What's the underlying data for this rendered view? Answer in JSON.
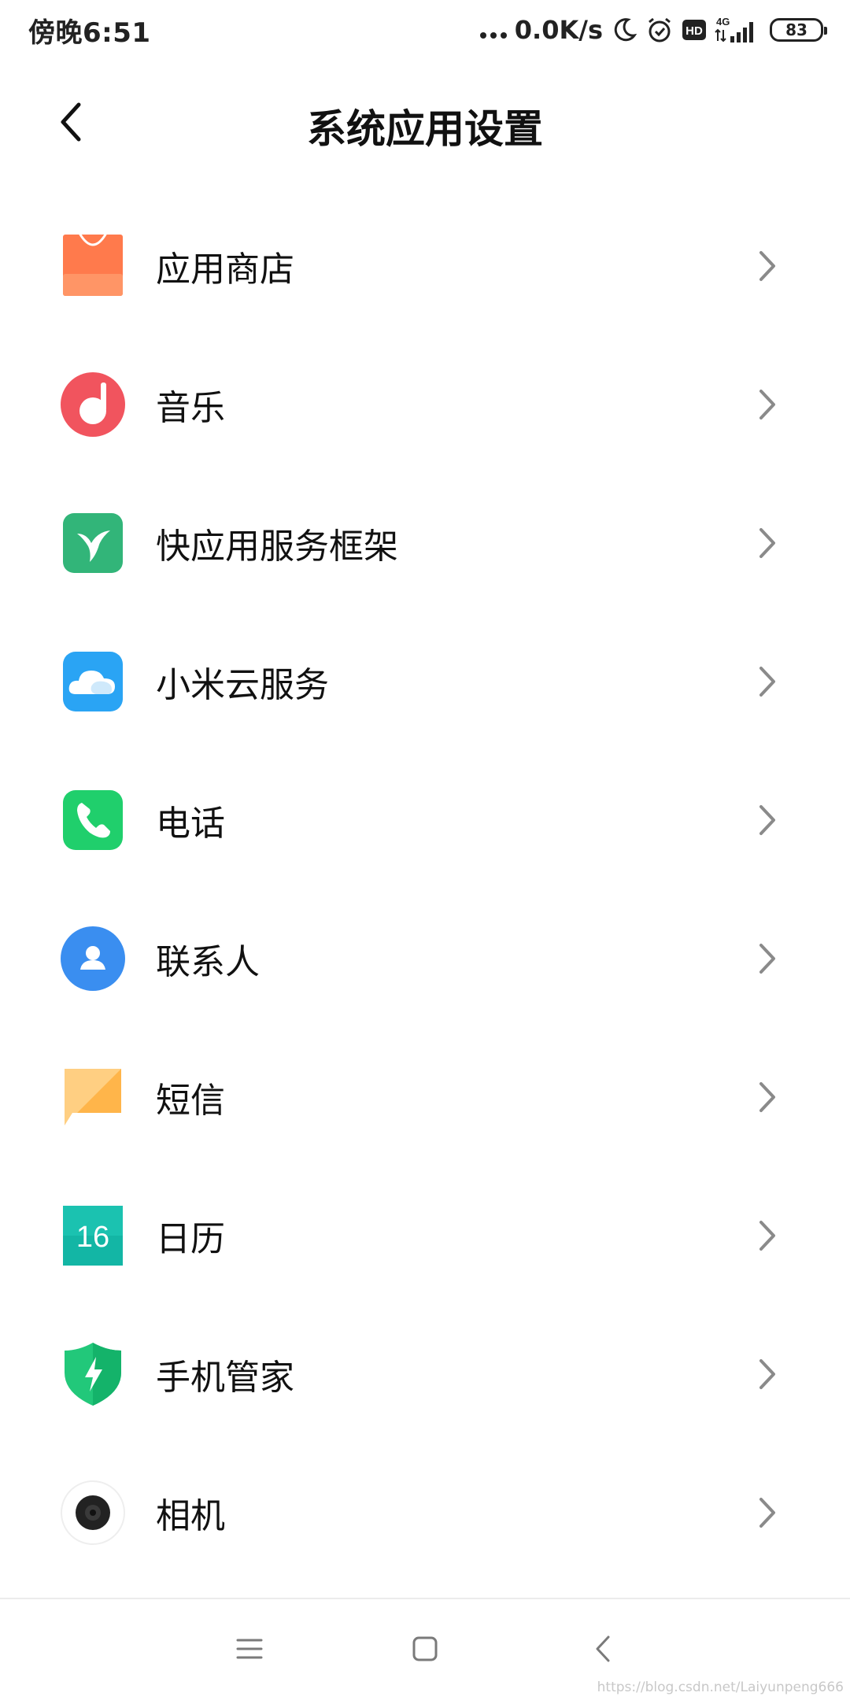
{
  "status_bar": {
    "time": "傍晚6:51",
    "network_speed": "0.0K/s",
    "network_type": "4G",
    "hd_label": "HD",
    "battery": "83",
    "icons": [
      "moon-icon",
      "alarm-icon",
      "hd-icon",
      "signal-icon",
      "battery-icon"
    ]
  },
  "header": {
    "back_icon": "back-arrow-icon",
    "title": "系统应用设置"
  },
  "app_list": [
    {
      "label": "应用商店",
      "icon": "app-store-icon",
      "color": "#ff7a4c"
    },
    {
      "label": "音乐",
      "icon": "music-icon",
      "color": "#f1545e"
    },
    {
      "label": "快应用服务框架",
      "icon": "quick-app-icon",
      "color": "#32b579"
    },
    {
      "label": "小米云服务",
      "icon": "cloud-icon",
      "color": "#2aa4f4"
    },
    {
      "label": "电话",
      "icon": "phone-icon",
      "color": "#20cf6c"
    },
    {
      "label": "联系人",
      "icon": "contacts-icon",
      "color": "#3a8ef0"
    },
    {
      "label": "短信",
      "icon": "messages-icon",
      "color": "#ffb54a"
    },
    {
      "label": "日历",
      "icon": "calendar-icon",
      "color": "#13b6a5",
      "icon_text": "16"
    },
    {
      "label": "手机管家",
      "icon": "security-icon",
      "color": "#22c87a"
    },
    {
      "label": "相机",
      "icon": "camera-icon",
      "color": "#222222"
    }
  ],
  "bottom_nav": {
    "items": [
      "menu-icon",
      "home-icon",
      "back-icon"
    ]
  },
  "watermark": "https://blog.csdn.net/Laiyunpeng666"
}
